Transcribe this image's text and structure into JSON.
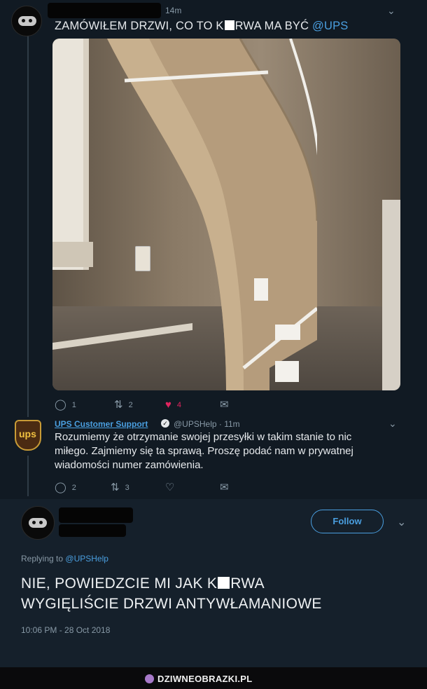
{
  "tweet1": {
    "time": "14m",
    "text_before": "ZAMÓWIŁEM DRZWI, CO TO K",
    "text_after": "RWA MA BYĆ",
    "mention": "@UPS",
    "replies": "1",
    "retweets": "2",
    "likes": "4"
  },
  "reply": {
    "name": "UPS Customer Support",
    "handle_time": "@UPSHelp · 11m",
    "logo_text": "ups",
    "text": "Rozumiemy że otrzymanie swojej przesyłki w takim stanie to nic miłego. Zajmiemy się ta sprawą. Proszę podać nam w prywatnej wiadomości numer zamówienia.",
    "replies": "2",
    "retweets": "3"
  },
  "main": {
    "follow_label": "Follow",
    "replying_prefix": "Replying to",
    "replying_to": "@UPSHelp",
    "text_line1_before": "NIE, POWIEDZCIE MI JAK K",
    "text_line1_after": "RWA",
    "text_line2": "WYGIĘLIŚCIE DRZWI ANTYWŁAMANIOWE",
    "timestamp": "10:06 PM - 28 Oct 2018"
  },
  "footer": {
    "brand": "DZIWNEOBRAZKI.PL"
  },
  "colors": {
    "accent": "#4a9fe0",
    "like": "#e0245e",
    "background": "#15202b"
  }
}
